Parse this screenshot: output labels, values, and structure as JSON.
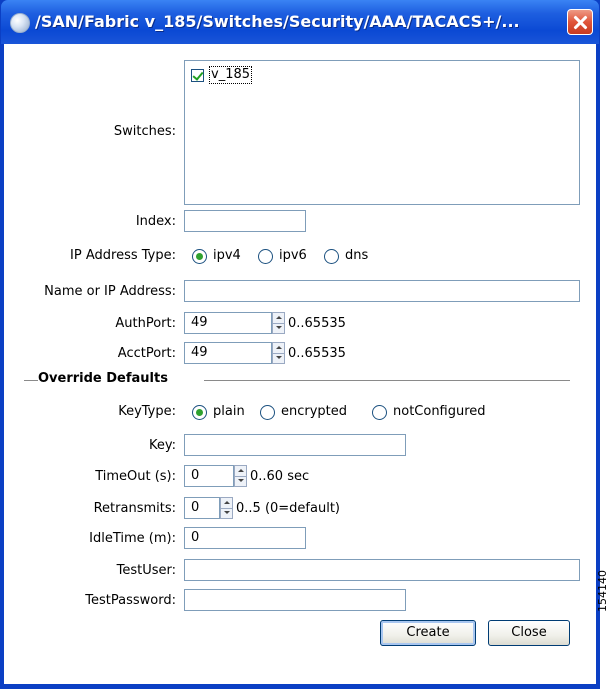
{
  "window": {
    "title": "/SAN/Fabric v_185/Switches/Security/AAA/TACACS+/...",
    "close_icon": "close-icon"
  },
  "form": {
    "switches_label": "Switches:",
    "switches": [
      {
        "name": "v_185",
        "checked": true
      }
    ],
    "index_label": "Index:",
    "index_value": "",
    "ip_type_label": "IP Address Type:",
    "ip_types": [
      {
        "label": "ipv4",
        "selected": true
      },
      {
        "label": "ipv6",
        "selected": false
      },
      {
        "label": "dns",
        "selected": false
      }
    ],
    "name_ip_label": "Name or IP Address:",
    "name_ip_value": "",
    "authport_label": "AuthPort:",
    "authport_value": "49",
    "authport_range": "0..65535",
    "acctport_label": "AcctPort:",
    "acctport_value": "49",
    "acctport_range": "0..65535"
  },
  "override": {
    "section_title": "Override Defaults",
    "keytype_label": "KeyType:",
    "keytypes": [
      {
        "label": "plain",
        "selected": true
      },
      {
        "label": "encrypted",
        "selected": false
      },
      {
        "label": "notConfigured",
        "selected": false
      }
    ],
    "key_label": "Key:",
    "key_value": "",
    "timeout_label": "TimeOut (s):",
    "timeout_value": "0",
    "timeout_range": "0..60 sec",
    "retransmits_label": "Retransmits:",
    "retransmits_value": "0",
    "retransmits_range": "0..5 (0=default)",
    "idletime_label": "IdleTime (m):",
    "idletime_value": "0",
    "testuser_label": "TestUser:",
    "testuser_value": "",
    "testpassword_label": "TestPassword:",
    "testpassword_value": ""
  },
  "buttons": {
    "create": "Create",
    "close": "Close"
  },
  "figure_id": "154140"
}
